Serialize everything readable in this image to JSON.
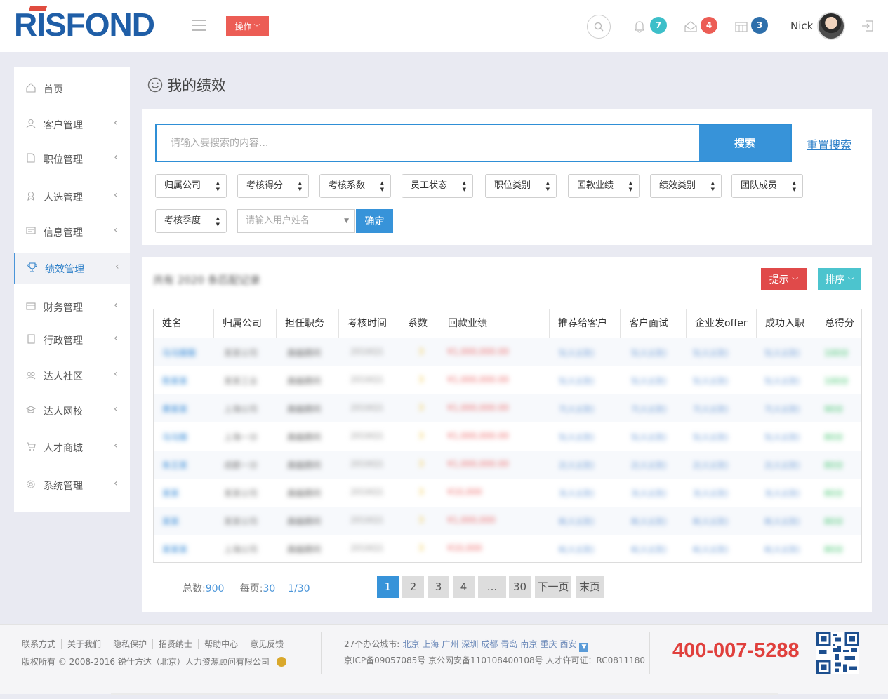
{
  "header": {
    "logo": "RISFOND",
    "op_button": "操作",
    "badges": {
      "notify": "7",
      "mail": "4",
      "calendar": "3"
    },
    "user_name": "Nick"
  },
  "sidebar": {
    "items": [
      {
        "label": "首页",
        "icon": "home-icon"
      },
      {
        "label": "客户管理",
        "icon": "user-icon"
      },
      {
        "label": "职位管理",
        "icon": "document-icon"
      },
      {
        "label": "人选管理",
        "icon": "person-badge-icon"
      },
      {
        "label": "信息管理",
        "icon": "message-icon"
      },
      {
        "label": "绩效管理",
        "icon": "trophy-icon"
      },
      {
        "label": "财务管理",
        "icon": "card-icon"
      },
      {
        "label": "行政管理",
        "icon": "tablet-icon"
      },
      {
        "label": "达人社区",
        "icon": "community-icon"
      },
      {
        "label": "达人网校",
        "icon": "graduation-icon"
      },
      {
        "label": "人才商城",
        "icon": "cart-icon"
      },
      {
        "label": "系统管理",
        "icon": "gear-icon"
      }
    ],
    "active_index": 5
  },
  "page": {
    "title": "我的绩效"
  },
  "search": {
    "placeholder": "请输入要搜索的内容...",
    "button": "搜索",
    "reset": "重置搜索"
  },
  "filters": [
    "归属公司",
    "考核得分",
    "考核系数",
    "员工状态",
    "职位类别",
    "回款业绩",
    "绩效类别",
    "团队成员",
    "考核季度"
  ],
  "name_filter": {
    "placeholder": "请输入用户姓名",
    "confirm": "确定"
  },
  "results": {
    "total_text": "共有 2020 条匹配记录",
    "tip_button": "提示",
    "sort_button": "排序"
  },
  "table": {
    "columns": [
      "姓名",
      "归属公司",
      "担任职务",
      "考核时间",
      "系数",
      "回款业绩",
      "推荐给客户",
      "客户面试",
      "企业发offer",
      "成功入职",
      "总得分"
    ],
    "rows": [
      [
        "马马猴猴",
        "某某公司",
        "高级顾问",
        "2016Q1",
        "3",
        "¥1,000,000.00",
        "5(人)(次)",
        "5(人)(次)",
        "5(人)(次)",
        "5(人)(次)",
        "100分"
      ],
      [
        "陈某某",
        "某某工业",
        "高级顾问",
        "2016Q1",
        "3",
        "¥1,000,000.00",
        "5(人)(次)",
        "5(人)(次)",
        "5(人)(次)",
        "5(人)(次)",
        "100分"
      ],
      [
        "黄某某",
        "上海公司",
        "高级顾问",
        "2016Q1",
        "3",
        "¥1,000,000.00",
        "7(人)(次)",
        "7(人)(次)",
        "7(人)(次)",
        "7(人)(次)",
        "90分"
      ],
      [
        "马马猴",
        "上海一分",
        "高级顾问",
        "2016Q1",
        "3",
        "¥1,000,000.00",
        "5(人)(次)",
        "5(人)(次)",
        "5(人)(次)",
        "5(人)(次)",
        "80分"
      ],
      [
        "朱王某",
        "成都一分",
        "高级顾问",
        "2016Q1",
        "3",
        "¥1,000,000.00",
        "2(人)(次)",
        "2(人)(次)",
        "2(人)(次)",
        "2(人)(次)",
        "80分"
      ],
      [
        "某某",
        "某某公司",
        "高级顾问",
        "2016Q1",
        "3",
        "¥10,000",
        "3(人)(次)",
        "3(人)(次)",
        "3(人)(次)",
        "3(人)(次)",
        "80分"
      ],
      [
        "某某",
        "某某公司",
        "高级顾问",
        "2016Q1",
        "3",
        "¥1,000,000",
        "8(人)(次)",
        "8(人)(次)",
        "8(人)(次)",
        "8(人)(次)",
        "80分"
      ],
      [
        "某某某",
        "上海公司",
        "高级顾问",
        "2016Q1",
        "3",
        "¥10,000",
        "6(人)(次)",
        "6(人)(次)",
        "6(人)(次)",
        "6(人)(次)",
        "80分"
      ]
    ]
  },
  "pagination": {
    "total_label": "总数:",
    "total": "900",
    "per_page_label": "每页:",
    "per_page": "30",
    "page_of": "1/30",
    "pages": [
      "1",
      "2",
      "3",
      "4",
      "...",
      "30"
    ],
    "next": "下一页",
    "last": "末页"
  },
  "footer": {
    "links": [
      "联系方式",
      "关于我们",
      "隐私保护",
      "招贤纳士",
      "帮助中心",
      "意见反馈"
    ],
    "copyright": "版权所有 © 2008-2016 锐仕方达（北京）人力资源顾问有限公司",
    "cities_label": "27个办公城市:",
    "cities": [
      "北京",
      "上海",
      "广州",
      "深圳",
      "成都",
      "青岛",
      "南京",
      "重庆",
      "西安"
    ],
    "icp": "京ICP备09057085号  京公网安备110108400108号  人才许可证：RC0811180",
    "phone": "400-007-5288"
  },
  "colors": {
    "primary": "#3793d9",
    "danger": "#e04a4a",
    "teal": "#4cc4ce",
    "brand": "#1f5ea7"
  }
}
